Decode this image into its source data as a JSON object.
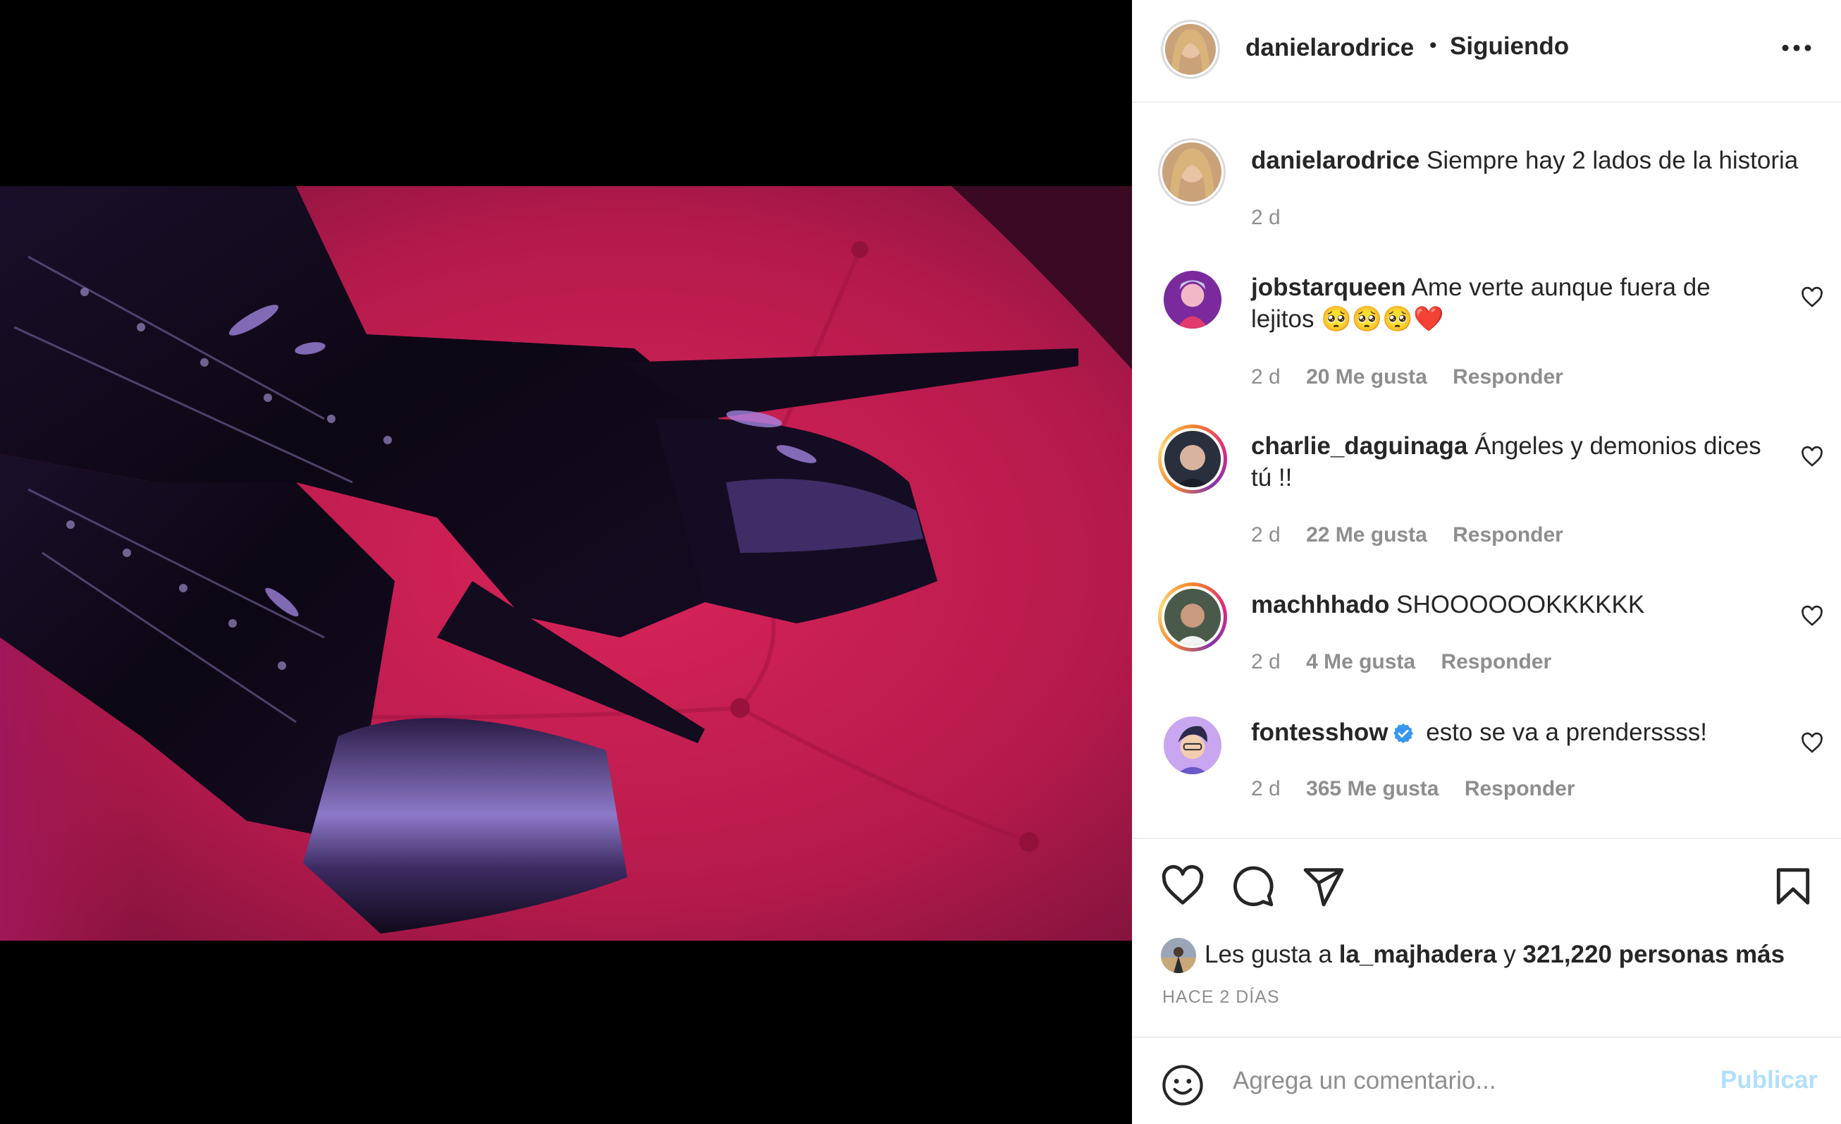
{
  "post": {
    "author": "danielarodrice",
    "follow_status": "Siguiendo",
    "separator": "•",
    "caption": "Siempre hay 2 lados de la historia",
    "caption_time": "2 d",
    "more_icon": "more-horizontal-icon"
  },
  "comments": [
    {
      "user": "jobstarqueen",
      "text": "Ame verte aunque fuera de lejitos 🥺🥺🥺❤️",
      "time": "2 d",
      "likes": "20 Me gusta",
      "reply": "Responder",
      "verified": false
    },
    {
      "user": "charlie_daguinaga",
      "text": "Ángeles y demonios dices tú !!",
      "time": "2 d",
      "likes": "22 Me gusta",
      "reply": "Responder",
      "verified": false
    },
    {
      "user": "machhhado",
      "text": "SHOOOOOOKKKKKK",
      "time": "2 d",
      "likes": "4 Me gusta",
      "reply": "Responder",
      "verified": false
    },
    {
      "user": "fontesshow",
      "text": "esto se va a prenderssss!",
      "time": "2 d",
      "likes": "365 Me gusta",
      "reply": "Responder",
      "verified": true
    }
  ],
  "likes_summary": {
    "prefix": "Les gusta a",
    "user": "la_majhadera",
    "connector": "y",
    "count": "321,220 personas más"
  },
  "timestamp": "HACE 2 DÍAS",
  "composer": {
    "placeholder": "Agrega un comentario...",
    "publish_label": "Publicar"
  },
  "icons": {
    "like": "heart-icon",
    "comment": "comment-bubble-icon",
    "share": "paper-plane-icon",
    "save": "bookmark-icon",
    "emoji": "emoji-smile-icon",
    "verified": "verified-badge-icon"
  },
  "colors": {
    "text": "#262626",
    "muted": "#8e8e8e",
    "publish_disabled": "#b2dffc",
    "verified": "#3897f0",
    "divider": "#efefef"
  }
}
